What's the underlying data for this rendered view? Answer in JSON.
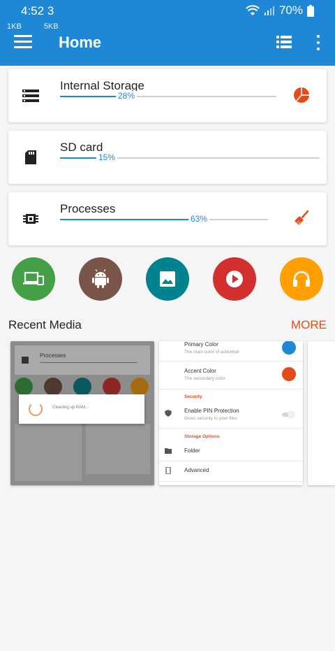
{
  "status": {
    "time": "4:52",
    "extra": "3",
    "battery": "70%",
    "net_up": "1KB",
    "net_down": "5KB"
  },
  "appbar": {
    "title": "Home",
    "menu_icon": "hamburger-icon",
    "view_icon": "list-view-icon",
    "overflow_icon": "more-vert-icon"
  },
  "storage": [
    {
      "label": "Internal Storage",
      "percent": 28,
      "percent_text": "28%",
      "icon": "storage-icon",
      "action_icon": "pie-chart-icon"
    },
    {
      "label": "SD card",
      "percent": 15,
      "percent_text": "15%",
      "icon": "sd-card-icon"
    },
    {
      "label": "Processes",
      "percent": 63,
      "percent_text": "63%",
      "icon": "cpu-chip-icon",
      "action_icon": "broom-icon"
    }
  ],
  "categories": [
    {
      "name": "devices",
      "icon": "devices-icon",
      "color": "#43a047"
    },
    {
      "name": "apps",
      "icon": "android-icon",
      "color": "#795548"
    },
    {
      "name": "images",
      "icon": "image-icon",
      "color": "#00838f"
    },
    {
      "name": "videos",
      "icon": "play-icon",
      "color": "#d32f2f"
    },
    {
      "name": "audio",
      "icon": "headphones-icon",
      "color": "#ffa000"
    }
  ],
  "recent": {
    "title": "Recent Media",
    "more": "MORE"
  },
  "thumb1": {
    "card_label": "Processes",
    "dialog_text": "Cleaning up RAM..."
  },
  "thumb2": {
    "primary_title": "Primary Color",
    "primary_sub": "The main color of actionbar",
    "accent_title": "Accent Color",
    "accent_sub": "The secondary color",
    "security": "Security",
    "pin_title": "Enable PIN Protection",
    "pin_sub": "Gives security to your files",
    "storage_options": "Storage Options",
    "folder": "Folder",
    "advanced": "Advanced",
    "primary_color": "#1e88d6",
    "accent_color": "#e64a19"
  },
  "colors": {
    "primary": "#1e88d6",
    "accent": "#e64a19"
  }
}
